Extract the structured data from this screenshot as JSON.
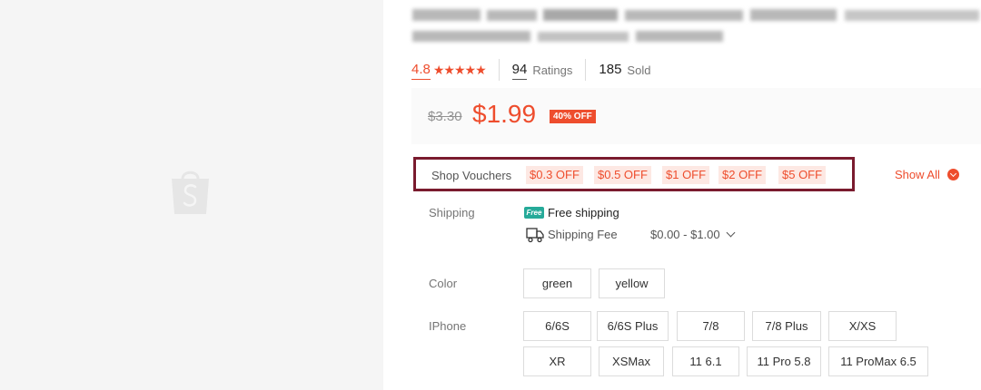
{
  "product": {
    "rating": "4.8",
    "stars_glyphs": "★★★★★",
    "ratings_count": "94",
    "ratings_label": "Ratings",
    "sold_count": "185",
    "sold_label": "Sold"
  },
  "price": {
    "original": "$3.30",
    "current": "$1.99",
    "discount_badge": "40% OFF"
  },
  "vouchers": {
    "label": "Shop Vouchers",
    "items": [
      "$0.3 OFF",
      "$0.5 OFF",
      "$1 OFF",
      "$2 OFF",
      "$5 OFF"
    ],
    "show_all": "Show All"
  },
  "shipping": {
    "label": "Shipping",
    "free_badge": "Free",
    "free_text": "Free shipping",
    "fee_label": "Shipping Fee",
    "fee_value": "$0.00 - $1.00"
  },
  "color": {
    "label": "Color",
    "options": [
      "green",
      "yellow"
    ]
  },
  "iphone": {
    "label": "IPhone",
    "options": [
      "6/6S",
      "6/6S Plus",
      "7/8",
      "7/8 Plus",
      "X/XS",
      "XR",
      "XSMax",
      "11 6.1",
      "11 Pro 5.8",
      "11 ProMax 6.5"
    ]
  },
  "colors": {
    "accent": "#ee4d2d",
    "free_green": "#26aa99",
    "highlight_border": "#7a1b2e",
    "voucher_bg": "#fde8e3"
  }
}
